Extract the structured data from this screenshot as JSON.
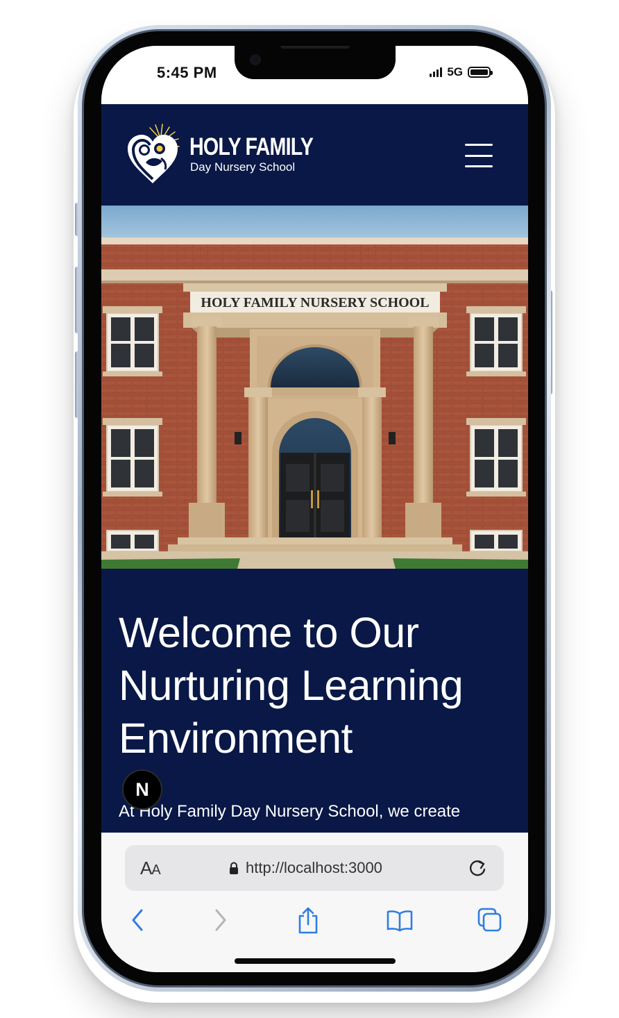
{
  "status_bar": {
    "time": "5:45 PM",
    "network": "5G"
  },
  "site": {
    "logo": {
      "title": "HOLY FAMILY",
      "subtitle": "Day Nursery School"
    },
    "menu_icon": "hamburger-menu-icon",
    "hero_image": {
      "sign_text": "HOLY FAMILY NURSERY SCHOOL"
    },
    "welcome": {
      "heading": "Welcome to Our Nurturing Learning Environment",
      "intro": "At Holy Family Day Nursery School, we create"
    },
    "dev_badge": "N"
  },
  "browser": {
    "text_size_label_large": "A",
    "text_size_label_small": "A",
    "url": "http://localhost:3000",
    "icons": [
      "lock-icon",
      "reload-icon",
      "back-icon",
      "forward-icon",
      "share-icon",
      "bookmarks-icon",
      "tabs-icon"
    ]
  },
  "colors": {
    "site_navy": "#091846",
    "browser_blue": "#2f7de1",
    "phone_frame": "#a8b6c8"
  }
}
